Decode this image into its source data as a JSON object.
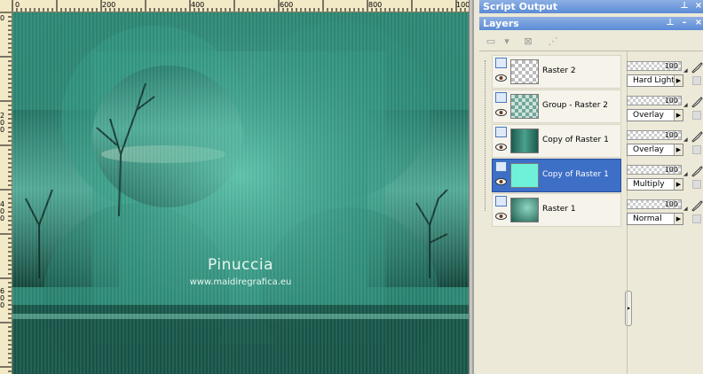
{
  "ruler": {
    "top_labels": [
      "0",
      "200",
      "400",
      "600",
      "800",
      "100"
    ],
    "left_labels": [
      "0",
      "2",
      "0",
      "0",
      "4",
      "0",
      "0",
      "6",
      "0",
      "0",
      "8",
      "0",
      "0"
    ]
  },
  "canvas": {
    "watermark_title": "Pinuccia",
    "watermark_url": "www.maidiregrafica.eu",
    "colors": {
      "base": "#2f8d77",
      "dark": "#0f3e35",
      "light": "#8fd6c2"
    }
  },
  "script_output_panel": {
    "title": "Script Output",
    "buttons": [
      "pin-icon",
      "close-icon"
    ]
  },
  "layers_panel": {
    "title": "Layers",
    "buttons": [
      "pin-icon",
      "minimize-icon",
      "close-icon"
    ],
    "layers": [
      {
        "name": "Raster 2",
        "opacity": "100",
        "blend": "Hard Light",
        "selected": false,
        "thumb": "checker"
      },
      {
        "name": "Group - Raster 2",
        "opacity": "100",
        "blend": "Overlay",
        "selected": false,
        "thumb": "checker-teal"
      },
      {
        "name": "Copy of Raster 1",
        "opacity": "100",
        "blend": "Overlay",
        "selected": false,
        "thumb": "teal-dark"
      },
      {
        "name": "Copy of Raster 1",
        "opacity": "100",
        "blend": "Multiply",
        "selected": true,
        "thumb": "cyan"
      },
      {
        "name": "Raster 1",
        "opacity": "100",
        "blend": "Normal",
        "selected": false,
        "thumb": "teal-gradient"
      }
    ]
  }
}
